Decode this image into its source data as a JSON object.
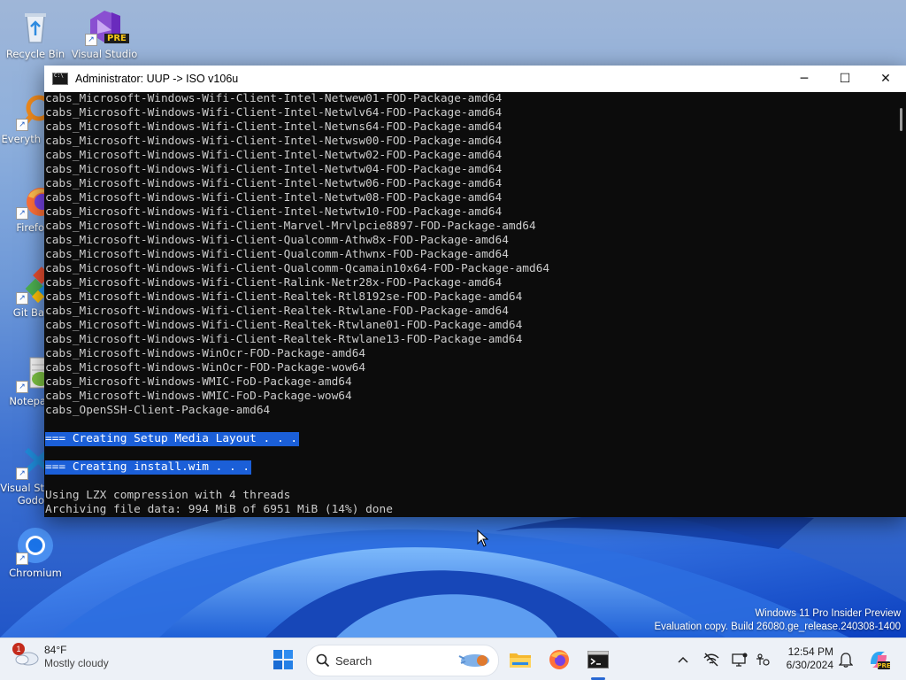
{
  "desktop": {
    "icons": [
      {
        "label": "Recycle Bin"
      },
      {
        "label": "Visual Studio",
        "badge": "PRE"
      },
      {
        "label": "Everyth"
      },
      {
        "label": "Firefo"
      },
      {
        "label": "Git Ba"
      },
      {
        "label": "Notepa"
      },
      {
        "label": "Visual St Godo"
      },
      {
        "label": "Chromium"
      }
    ]
  },
  "window": {
    "title": "Administrator:  UUP -> ISO v106u",
    "minimize": "─",
    "maximize": "☐",
    "close": "✕"
  },
  "console": {
    "lines": [
      "cabs_Microsoft-Windows-Wifi-Client-Intel-Netwew01-FOD-Package-amd64",
      "cabs_Microsoft-Windows-Wifi-Client-Intel-Netwlv64-FOD-Package-amd64",
      "cabs_Microsoft-Windows-Wifi-Client-Intel-Netwns64-FOD-Package-amd64",
      "cabs_Microsoft-Windows-Wifi-Client-Intel-Netwsw00-FOD-Package-amd64",
      "cabs_Microsoft-Windows-Wifi-Client-Intel-Netwtw02-FOD-Package-amd64",
      "cabs_Microsoft-Windows-Wifi-Client-Intel-Netwtw04-FOD-Package-amd64",
      "cabs_Microsoft-Windows-Wifi-Client-Intel-Netwtw06-FOD-Package-amd64",
      "cabs_Microsoft-Windows-Wifi-Client-Intel-Netwtw08-FOD-Package-amd64",
      "cabs_Microsoft-Windows-Wifi-Client-Intel-Netwtw10-FOD-Package-amd64",
      "cabs_Microsoft-Windows-Wifi-Client-Marvel-Mrvlpcie8897-FOD-Package-amd64",
      "cabs_Microsoft-Windows-Wifi-Client-Qualcomm-Athw8x-FOD-Package-amd64",
      "cabs_Microsoft-Windows-Wifi-Client-Qualcomm-Athwnx-FOD-Package-amd64",
      "cabs_Microsoft-Windows-Wifi-Client-Qualcomm-Qcamain10x64-FOD-Package-amd64",
      "cabs_Microsoft-Windows-Wifi-Client-Ralink-Netr28x-FOD-Package-amd64",
      "cabs_Microsoft-Windows-Wifi-Client-Realtek-Rtl8192se-FOD-Package-amd64",
      "cabs_Microsoft-Windows-Wifi-Client-Realtek-Rtwlane-FOD-Package-amd64",
      "cabs_Microsoft-Windows-Wifi-Client-Realtek-Rtwlane01-FOD-Package-amd64",
      "cabs_Microsoft-Windows-Wifi-Client-Realtek-Rtwlane13-FOD-Package-amd64",
      "cabs_Microsoft-Windows-WinOcr-FOD-Package-amd64",
      "cabs_Microsoft-Windows-WinOcr-FOD-Package-wow64",
      "cabs_Microsoft-Windows-WMIC-FoD-Package-amd64",
      "cabs_Microsoft-Windows-WMIC-FoD-Package-wow64",
      "cabs_OpenSSH-Client-Package-amd64"
    ],
    "section1": "=== Creating Setup Media Layout . . .",
    "section2": "=== Creating install.wim . . .",
    "compression": "Using LZX compression with 4 threads",
    "progress": "Archiving file data: 994 MiB of 6951 MiB (14%) done",
    "highlight_color": "#1b5fd8",
    "background_color": "#0c0c0c",
    "text_color": "#cccccc"
  },
  "watermark": {
    "line1": "Windows 11 Pro Insider Preview",
    "line2": "Evaluation copy. Build 26080.ge_release.240308-1400"
  },
  "taskbar": {
    "weather": {
      "temp": "84°F",
      "condition": "Mostly cloudy",
      "badge": "1"
    },
    "search_label": "Search",
    "apps": [
      "start-icon",
      "search-icon",
      "file-explorer-icon",
      "firefox-icon",
      "terminal-icon"
    ],
    "tray": [
      "chevron-up-icon",
      "network-offline-icon",
      "display-icon",
      "accessibility-icon",
      "bell-icon",
      "copilot-icon"
    ],
    "clock": {
      "time": "12:54 PM",
      "date": "6/30/2024"
    }
  }
}
